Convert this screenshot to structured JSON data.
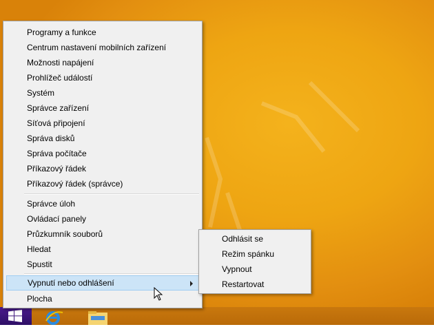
{
  "context_menu": {
    "items": [
      "Programy a funkce",
      "Centrum nastavení mobilních zařízení",
      "Možnosti napájení",
      "Prohlížeč událostí",
      "Systém",
      "Správce zařízení",
      "Síťová připojení",
      "Správa disků",
      "Správa počítače",
      "Příkazový řádek",
      "Příkazový řádek (správce)",
      "Správce úloh",
      "Ovládací panely",
      "Průzkumník souborů",
      "Hledat",
      "Spustit",
      "Vypnutí nebo odhlášení",
      "Plocha"
    ],
    "highlighted": "Vypnutí nebo odhlášení"
  },
  "submenu": {
    "items": [
      "Odhlásit se",
      "Režim spánku",
      "Vypnout",
      "Restartovat"
    ]
  },
  "taskbar": {
    "icons": [
      "windows-logo-icon",
      "internet-explorer-icon",
      "file-explorer-icon"
    ]
  },
  "colors": {
    "desktop": "#eea512",
    "start_button": "#2e0f66",
    "menu_bg": "#f0f0f0",
    "highlight": "#cce4f7"
  }
}
